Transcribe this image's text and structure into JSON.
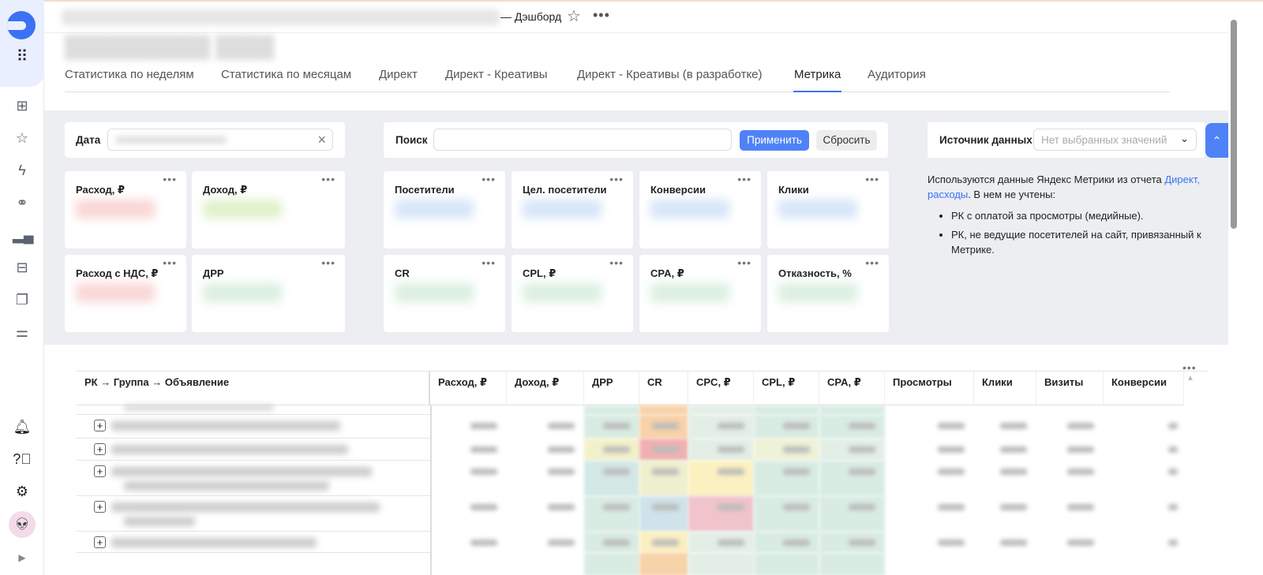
{
  "header": {
    "dash_label": "— Дэшборд",
    "more": "•••"
  },
  "tabs": [
    "Статистика по неделям",
    "Статистика по месяцам",
    "Директ",
    "Директ - Креативы",
    "Директ - Креативы (в разработке)",
    "Метрика",
    "Аудитория"
  ],
  "active_tab": "Метрика",
  "filters": {
    "date_label": "Дата",
    "clear_icon": "×",
    "search_label": "Поиск",
    "search_value": "",
    "apply": "Применить",
    "reset": "Сбросить",
    "source_label": "Источник данных",
    "source_placeholder": "Нет выбранных значений"
  },
  "kpi": [
    {
      "title": "Расход, ₽",
      "color": "#f08a8a"
    },
    {
      "title": "Доход, ₽",
      "color": "#a8d86a"
    },
    {
      "title": "Посетители",
      "color": "#8fb4f0"
    },
    {
      "title": "Цел. посетители",
      "color": "#8fb4f0"
    },
    {
      "title": "Конверсии",
      "color": "#8fb4f0"
    },
    {
      "title": "Клики",
      "color": "#8fb4f0"
    },
    {
      "title": "Расход с НДС, ₽",
      "color": "#f08a8a"
    },
    {
      "title": "ДРР",
      "color": "#9ad0a8"
    },
    {
      "title": "CR",
      "color": "#9ad0a8"
    },
    {
      "title": "CPL, ₽",
      "color": "#9ad0a8"
    },
    {
      "title": "CPA, ₽",
      "color": "#9ad0a8"
    },
    {
      "title": "Отказность, %",
      "color": "#9ad0a8"
    }
  ],
  "kpi_more": "•••",
  "info": {
    "line1": "Используются данные Яндекс Метрики из отчета ",
    "link": "Директ, расходы",
    "line2": ". В нем не учтены:",
    "bullets": [
      "РК с оплатой за просмотры (медийные).",
      "РК, не ведущие посетителей на сайт, привязанный к Метрике."
    ]
  },
  "table": {
    "columns": [
      "РК → Группа → Объявление",
      "Расход, ₽",
      "Доход, ₽",
      "ДРР",
      "CR",
      "CPC, ₽",
      "CPL, ₽",
      "CPA, ₽",
      "Просмотры",
      "Клики",
      "Визиты",
      "Конверсии"
    ],
    "more": "•••",
    "row_colors": [
      [
        "#d9ece3",
        "#f8d2a8",
        "#e3efe6",
        "#d9ece3",
        "#d9ece3"
      ],
      [
        "#f3f1c9",
        "#f1b1b1",
        "#e3efe6",
        "#eef2d6",
        "#e3efe6"
      ],
      [
        "#d3e9e6",
        "#eef0cf",
        "#fbf1c0",
        "#d9ece3",
        "#d9ece3"
      ],
      [
        "#d9ece3",
        "#cfe3ea",
        "#f1c3cb",
        "#d9ece3",
        "#d9ece3"
      ],
      [
        "#d9ece3",
        "#fbefc2",
        "#e3efe6",
        "#d9ece3",
        "#d9ece3"
      ]
    ]
  }
}
